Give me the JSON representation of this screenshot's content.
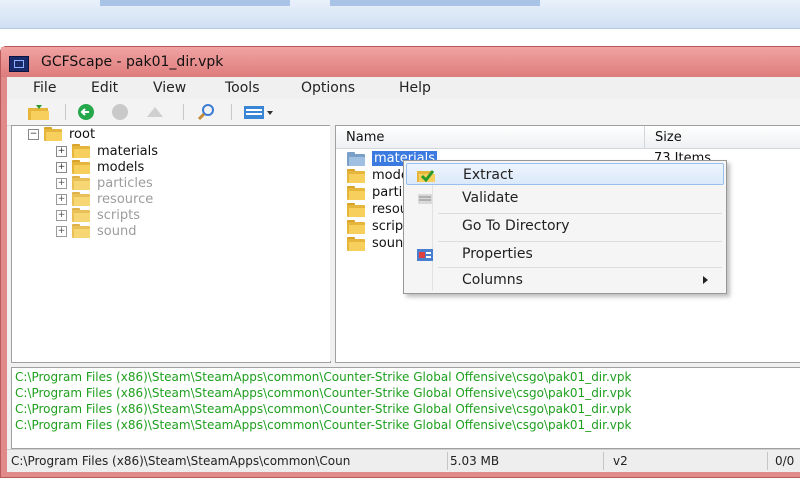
{
  "window": {
    "title": "GCFScape - pak01_dir.vpk"
  },
  "menu": [
    "File",
    "Edit",
    "View",
    "Tools",
    "Options",
    "Help"
  ],
  "tree": {
    "root": "root",
    "children": [
      "materials",
      "models",
      "particles",
      "resource",
      "scripts",
      "sound"
    ]
  },
  "list": {
    "columns": {
      "name": "Name",
      "size": "Size"
    },
    "rows": [
      {
        "name": "materials",
        "size": "73 Items"
      },
      {
        "name": "models",
        "size": ""
      },
      {
        "name": "particles",
        "size": ""
      },
      {
        "name": "resource",
        "size": ""
      },
      {
        "name": "scripts",
        "size": ""
      },
      {
        "name": "sound",
        "size": ""
      }
    ]
  },
  "context_menu": {
    "extract": "Extract",
    "validate": "Validate",
    "go_to_directory": "Go To Directory",
    "properties": "Properties",
    "columns": "Columns"
  },
  "log": {
    "lines": [
      "C:\\Program Files (x86)\\Steam\\SteamApps\\common\\Counter-Strike Global Offensive\\csgo\\pak01_dir.vpk",
      "C:\\Program Files (x86)\\Steam\\SteamApps\\common\\Counter-Strike Global Offensive\\csgo\\pak01_dir.vpk",
      "C:\\Program Files (x86)\\Steam\\SteamApps\\common\\Counter-Strike Global Offensive\\csgo\\pak01_dir.vpk",
      "C:\\Program Files (x86)\\Steam\\SteamApps\\common\\Counter-Strike Global Offensive\\csgo\\pak01_dir.vpk"
    ]
  },
  "status": {
    "path": "C:\\Program Files (x86)\\Steam\\SteamApps\\common\\Coun",
    "size": "5.03 MB",
    "version": "v2",
    "count": "0/0"
  },
  "colors": {
    "titlebar": "#de7c7c",
    "selection": "#3b7be0",
    "log_text": "#1ea01e",
    "folder": "#f6cf5c"
  }
}
